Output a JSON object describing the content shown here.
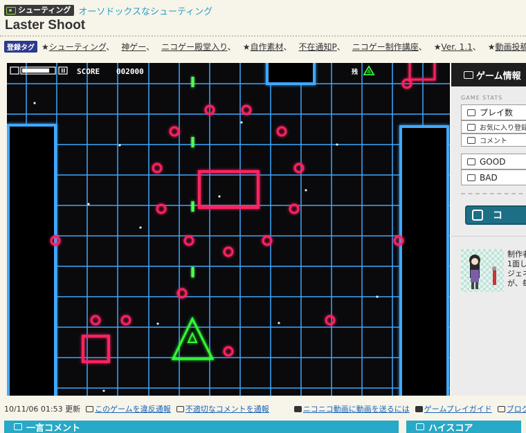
{
  "header": {
    "genre_badge": "シューティング",
    "genre_link": "オーソドックスなシューティング",
    "title": "Laster Shoot"
  },
  "tags": {
    "label": "登録タグ",
    "items": [
      {
        "prefix": "★",
        "text": "シューティング",
        "suffix": "、"
      },
      {
        "prefix": "",
        "text": "神ゲー",
        "suffix": "、"
      },
      {
        "prefix": "",
        "text": "ニコゲー殿堂入り",
        "suffix": "、"
      },
      {
        "prefix": "★",
        "text": "自作素材",
        "suffix": "、"
      },
      {
        "prefix": "",
        "text": "不在通知P",
        "suffix": "、"
      },
      {
        "prefix": "",
        "text": "ニコゲー制作講座",
        "suffix": "、"
      },
      {
        "prefix": "★",
        "text": "Ver. 1.1",
        "suffix": "、"
      },
      {
        "prefix": "★",
        "text": "動画投稿対応",
        "suffix": ""
      }
    ]
  },
  "game": {
    "score_label": "SCORE",
    "score_value": "002000",
    "lives_label": "残",
    "volume_level": 0.85,
    "colors": {
      "grid": "#3fa9ff",
      "enemy": "#ff2060",
      "player": "#33ff33",
      "bullet": "#55ff55",
      "background": "#0a0a0d"
    }
  },
  "side_panel": {
    "header": "ゲーム情報",
    "stats_label": "GAME STATS",
    "stats": [
      {
        "label": "プレイ数",
        "icon": "gamepad-icon",
        "size": "big"
      },
      {
        "label": "お気に入り登録",
        "icon": "list-icon",
        "size": "small"
      },
      {
        "label": "コメント",
        "icon": "comment-icon",
        "size": "small"
      },
      {
        "label": "GOOD",
        "icon": "good-icon",
        "size": "big"
      },
      {
        "label": "BAD",
        "icon": "bad-icon",
        "size": "big"
      }
    ],
    "action_label": "コ",
    "author_lines": [
      "制作者",
      "1面し",
      "ジェネ",
      "が、毎"
    ]
  },
  "meta": {
    "date": "10/11/06 01:53 更新",
    "links": [
      {
        "text": "このゲームを違反通報",
        "link": true
      },
      {
        "text": "不適切なコメントを通報",
        "link": true
      },
      {
        "text": "ニコニコ動画に動画を送るには",
        "link": true
      },
      {
        "text": "ゲームプレイガイド",
        "link": true
      },
      {
        "text": "ブログ",
        "link": true
      }
    ]
  },
  "bottom": {
    "comment_section": "一言コメント",
    "highscore_section": "ハイスコア"
  }
}
